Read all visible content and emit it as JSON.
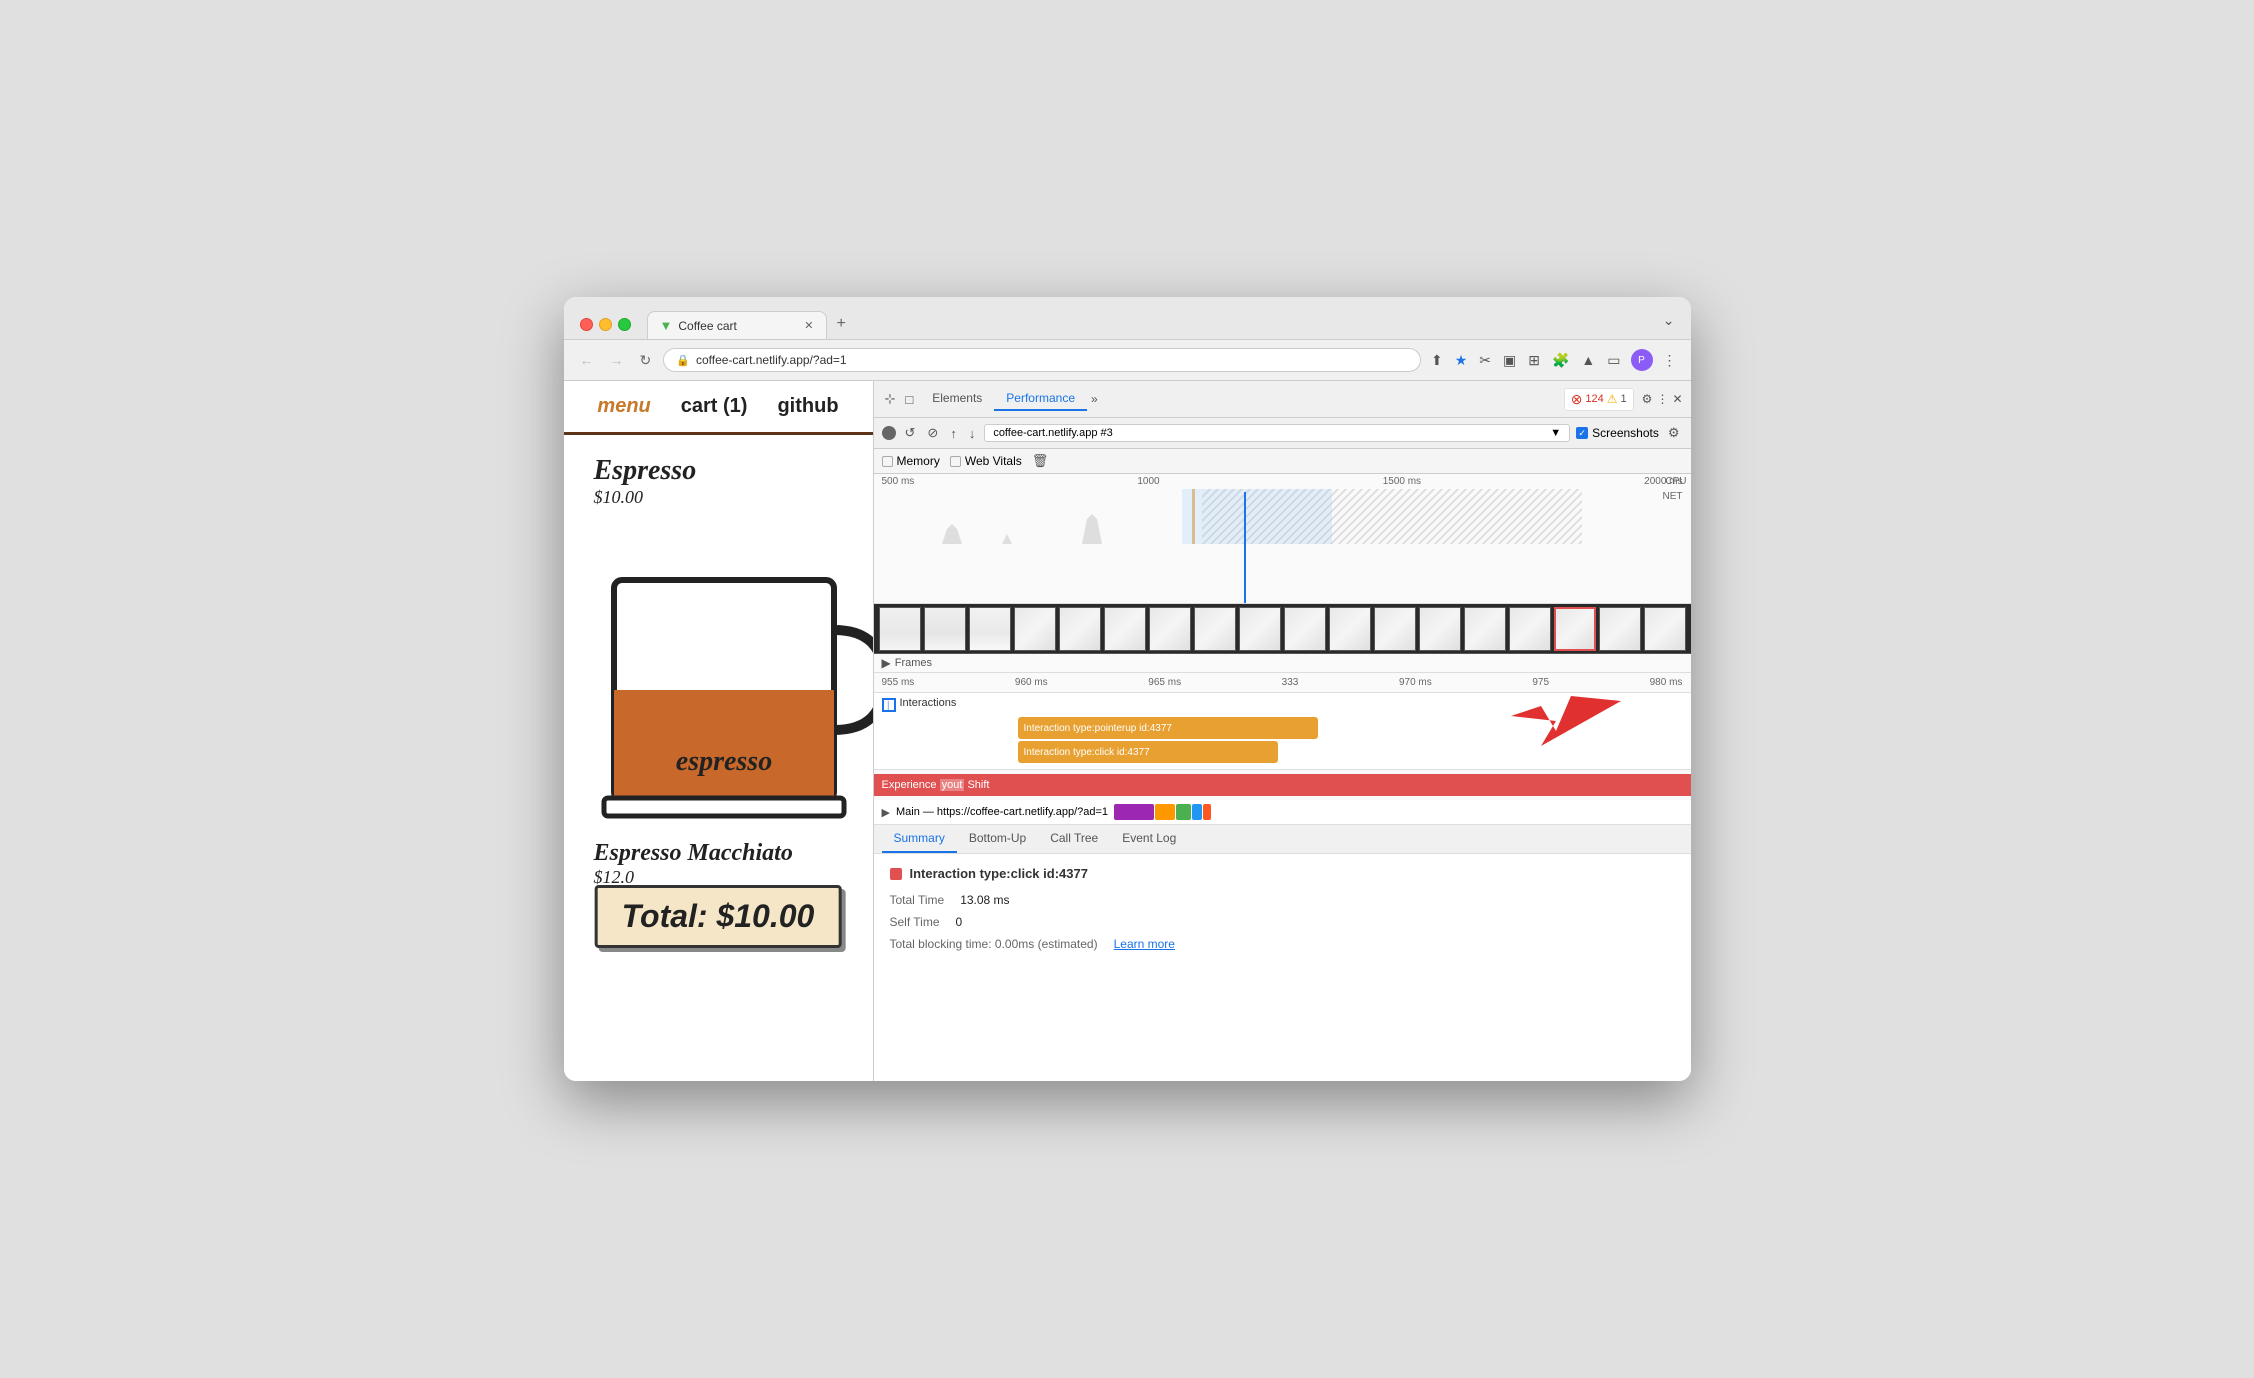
{
  "browser": {
    "traffic_lights": {
      "close": "close",
      "minimize": "minimize",
      "maximize": "maximize"
    },
    "tab": {
      "favicon": "▼",
      "title": "Coffee cart",
      "close": "✕"
    },
    "new_tab": "+",
    "address_bar": {
      "url": "coffee-cart.netlify.app/?ad=1",
      "lock_icon": "🔒"
    },
    "nav": {
      "back": "←",
      "forward": "→",
      "refresh": "↻"
    },
    "more_options": "⋮",
    "chevron_down": "⌄"
  },
  "site": {
    "nav": {
      "menu": "menu",
      "cart": "cart (1)",
      "github": "github"
    },
    "product1": {
      "name": "Espresso",
      "price": "$10.00",
      "cup_label": "espresso"
    },
    "product2": {
      "name": "Espresso Macchiato",
      "price": "$12.0"
    },
    "total": "Total: $10.00"
  },
  "devtools": {
    "header_tabs": {
      "cursor": "⊹",
      "mobile": "□",
      "elements": "Elements",
      "performance": "Performance",
      "more": "»"
    },
    "error_count": "124",
    "warning_count": "1",
    "gear": "⚙",
    "dots": "⋮",
    "close": "✕",
    "toolbar2": {
      "record": "●",
      "refresh": "↺",
      "stop": "⊘",
      "upload": "↑",
      "download": "↓",
      "source": "coffee-cart.netlify.app #3",
      "screenshots_label": "Screenshots",
      "settings": "⚙"
    },
    "metrics": {
      "memory": "Memory",
      "web_vitals": "Web Vitals",
      "trash": "🗑"
    },
    "timeline": {
      "labels": [
        "500 ms",
        "1000",
        "1500 ms",
        "2000 ms"
      ],
      "cpu_label": "CPU",
      "net_label": "NET"
    },
    "ruler": {
      "labels": [
        "955 ms",
        "960 ms",
        "965 ms",
        "333",
        "970 ms",
        "975",
        "980 ms"
      ]
    },
    "interactions": {
      "label": "Interactions",
      "items": [
        "Interaction type:pointerup id:4377",
        "Interaction type:click id:4377"
      ]
    },
    "experience": {
      "highlight": "yout",
      "text": "Experience yout Shift"
    },
    "main_thread": {
      "label": "Main — https://coffee-cart.netlify.app/?ad=1"
    },
    "bottom_tabs": [
      "Summary",
      "Bottom-Up",
      "Call Tree",
      "Event Log"
    ],
    "summary": {
      "active_tab": "Summary",
      "title": "Interaction type:click id:4377",
      "color": "#e05050",
      "fields": [
        {
          "label": "Total Time",
          "value": "13.08 ms"
        },
        {
          "label": "Self Time",
          "value": "0"
        },
        {
          "label": "Total blocking time:",
          "value": "0.00ms (estimated)"
        },
        {
          "learn_more": "Learn more"
        }
      ]
    }
  }
}
